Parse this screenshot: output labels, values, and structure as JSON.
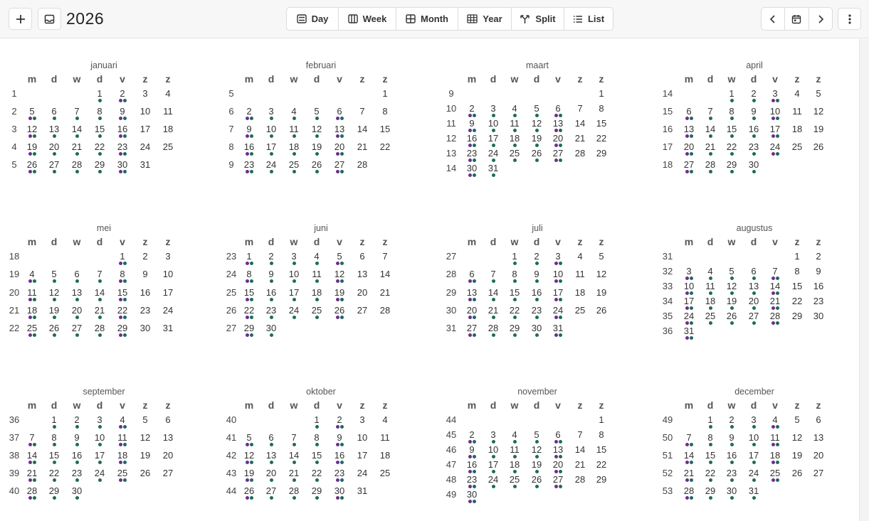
{
  "toolbar": {
    "add_icon": "plus-icon",
    "inbox_icon": "inbox-icon",
    "year": "2026",
    "views": [
      {
        "label": "Day",
        "icon": "day-view-icon"
      },
      {
        "label": "Week",
        "icon": "week-view-icon"
      },
      {
        "label": "Month",
        "icon": "month-view-icon"
      },
      {
        "label": "Year",
        "icon": "year-view-icon"
      },
      {
        "label": "Split",
        "icon": "split-view-icon"
      },
      {
        "label": "List",
        "icon": "list-view-icon"
      }
    ],
    "prev_icon": "chevron-left-icon",
    "today_icon": "calendar-today-icon",
    "next_icon": "chevron-right-icon",
    "menu_icon": "more-vertical-icon"
  },
  "colors": {
    "purple": "#6b2f8f",
    "teal": "#1e6b5e"
  },
  "weekday_headers": [
    "m",
    "d",
    "w",
    "d",
    "v",
    "z",
    "z"
  ],
  "months": [
    {
      "name": "januari",
      "week_numbers": [
        "1",
        "2",
        "3",
        "4",
        "5"
      ],
      "first_weekday": 3,
      "days": 31,
      "events": {
        "1": "t",
        "2": "pt",
        "5": "pt",
        "6": "t",
        "7": "t",
        "8": "t",
        "9": "pt",
        "12": "pt",
        "13": "t",
        "14": "t",
        "15": "t",
        "16": "pt",
        "19": "pt",
        "20": "t",
        "21": "t",
        "22": "t",
        "23": "pt",
        "26": "pt",
        "27": "t",
        "28": "t",
        "29": "t",
        "30": "pt"
      }
    },
    {
      "name": "februari",
      "week_numbers": [
        "5",
        "6",
        "7",
        "8",
        "9"
      ],
      "first_weekday": 6,
      "days": 28,
      "events": {
        "2": "pt",
        "3": "t",
        "4": "t",
        "5": "t",
        "6": "pt",
        "9": "pt",
        "10": "t",
        "11": "t",
        "12": "t",
        "13": "pt",
        "16": "pt",
        "17": "t",
        "18": "t",
        "19": "t",
        "20": "pt",
        "23": "pt",
        "24": "t",
        "25": "t",
        "26": "t",
        "27": "pt"
      }
    },
    {
      "name": "maart",
      "week_numbers": [
        "9",
        "10",
        "11",
        "12",
        "13",
        "14"
      ],
      "first_weekday": 6,
      "days": 31,
      "events": {
        "2": "pt",
        "3": "t",
        "4": "t",
        "5": "t",
        "6": "pt",
        "9": "pt",
        "10": "t",
        "11": "t",
        "12": "t",
        "13": "pt",
        "16": "pt",
        "17": "t",
        "18": "t",
        "19": "t",
        "20": "pt",
        "23": "pt",
        "24": "t",
        "25": "t",
        "26": "t",
        "27": "pt",
        "30": "pt",
        "31": "t"
      }
    },
    {
      "name": "april",
      "week_numbers": [
        "14",
        "15",
        "16",
        "17",
        "18"
      ],
      "first_weekday": 2,
      "days": 30,
      "events": {
        "1": "t",
        "2": "t",
        "3": "pt",
        "6": "pt",
        "7": "t",
        "8": "t",
        "9": "t",
        "10": "pt",
        "13": "pt",
        "14": "t",
        "15": "t",
        "16": "t",
        "17": "pt",
        "20": "pt",
        "21": "t",
        "22": "t",
        "23": "t",
        "24": "pt",
        "27": "pt",
        "28": "t",
        "29": "t",
        "30": "t"
      }
    },
    {
      "name": "mei",
      "week_numbers": [
        "18",
        "19",
        "20",
        "21",
        "22"
      ],
      "first_weekday": 4,
      "days": 31,
      "events": {
        "1": "pt",
        "4": "pt",
        "5": "t",
        "6": "t",
        "7": "t",
        "8": "pt",
        "11": "pt",
        "12": "t",
        "13": "t",
        "14": "t",
        "15": "pt",
        "18": "pt",
        "19": "t",
        "20": "t",
        "21": "t",
        "22": "pt",
        "25": "pt",
        "26": "t",
        "27": "t",
        "28": "t",
        "29": "pt"
      }
    },
    {
      "name": "juni",
      "week_numbers": [
        "23",
        "24",
        "25",
        "26",
        "27"
      ],
      "first_weekday": 0,
      "days": 30,
      "events": {
        "1": "pt",
        "2": "t",
        "3": "t",
        "4": "t",
        "5": "pt",
        "8": "pt",
        "9": "t",
        "10": "t",
        "11": "t",
        "12": "pt",
        "15": "pt",
        "16": "t",
        "17": "t",
        "18": "t",
        "19": "pt",
        "22": "pt",
        "23": "t",
        "24": "t",
        "25": "t",
        "26": "pt",
        "29": "pt",
        "30": "t"
      }
    },
    {
      "name": "juli",
      "week_numbers": [
        "27",
        "28",
        "29",
        "30",
        "31"
      ],
      "first_weekday": 2,
      "days": 31,
      "events": {
        "1": "t",
        "2": "t",
        "3": "pt",
        "6": "pt",
        "7": "t",
        "8": "t",
        "9": "t",
        "10": "pt",
        "13": "pt",
        "14": "t",
        "15": "t",
        "16": "t",
        "17": "pt",
        "20": "pt",
        "21": "t",
        "22": "t",
        "23": "t",
        "24": "pt",
        "27": "pt",
        "28": "t",
        "29": "t",
        "30": "t",
        "31": "pt"
      }
    },
    {
      "name": "augustus",
      "week_numbers": [
        "31",
        "32",
        "33",
        "34",
        "35",
        "36"
      ],
      "first_weekday": 5,
      "days": 31,
      "events": {
        "3": "pt",
        "4": "t",
        "5": "t",
        "6": "t",
        "7": "pt",
        "10": "pt",
        "11": "t",
        "12": "t",
        "13": "t",
        "14": "pt",
        "17": "pt",
        "18": "t",
        "19": "t",
        "20": "t",
        "21": "pt",
        "24": "pt",
        "25": "t",
        "26": "t",
        "27": "t",
        "28": "pt",
        "31": "pt"
      }
    },
    {
      "name": "september",
      "week_numbers": [
        "36",
        "37",
        "38",
        "39",
        "40"
      ],
      "first_weekday": 1,
      "days": 30,
      "events": {
        "1": "t",
        "2": "t",
        "3": "t",
        "4": "pt",
        "7": "pt",
        "8": "t",
        "9": "t",
        "10": "t",
        "11": "pt",
        "14": "pt",
        "15": "t",
        "16": "t",
        "17": "t",
        "18": "pt",
        "21": "pt",
        "22": "t",
        "23": "t",
        "24": "t",
        "25": "pt",
        "28": "pt",
        "29": "t",
        "30": "t"
      }
    },
    {
      "name": "oktober",
      "week_numbers": [
        "40",
        "41",
        "42",
        "43",
        "44"
      ],
      "first_weekday": 3,
      "days": 31,
      "events": {
        "1": "t",
        "2": "pt",
        "5": "pt",
        "6": "t",
        "7": "t",
        "8": "t",
        "9": "pt",
        "12": "pt",
        "13": "t",
        "14": "t",
        "15": "t",
        "16": "pt",
        "19": "pt",
        "20": "t",
        "21": "t",
        "22": "t",
        "23": "pt",
        "26": "pt",
        "27": "t",
        "28": "t",
        "29": "t",
        "30": "pt"
      }
    },
    {
      "name": "november",
      "week_numbers": [
        "44",
        "45",
        "46",
        "47",
        "48",
        "49"
      ],
      "first_weekday": 6,
      "days": 30,
      "events": {
        "2": "pt",
        "3": "t",
        "4": "t",
        "5": "t",
        "6": "pt",
        "9": "pt",
        "10": "t",
        "11": "t",
        "12": "t",
        "13": "pt",
        "16": "pt",
        "17": "t",
        "18": "t",
        "19": "t",
        "20": "pt",
        "23": "pt",
        "24": "t",
        "25": "t",
        "26": "t",
        "27": "pt",
        "30": "pt"
      }
    },
    {
      "name": "december",
      "week_numbers": [
        "49",
        "50",
        "51",
        "52",
        "53"
      ],
      "first_weekday": 1,
      "days": 31,
      "events": {
        "1": "t",
        "2": "t",
        "3": "t",
        "4": "pt",
        "7": "pt",
        "8": "t",
        "9": "t",
        "10": "t",
        "11": "pt",
        "14": "pt",
        "15": "t",
        "16": "t",
        "17": "t",
        "18": "pt",
        "21": "pt",
        "22": "t",
        "23": "t",
        "24": "t",
        "25": "pt",
        "28": "pt",
        "29": "t",
        "30": "t",
        "31": "t"
      }
    }
  ]
}
